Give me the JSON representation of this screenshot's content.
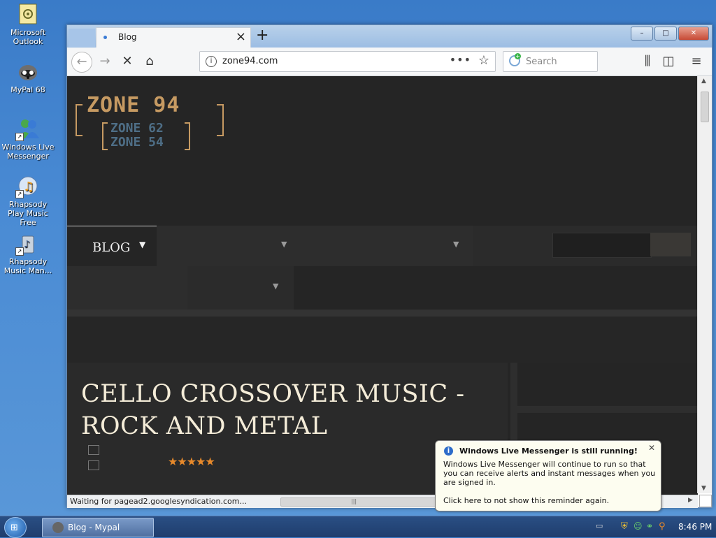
{
  "desktop_icons": [
    {
      "label": "Microsoft Outlook",
      "icon": "outlook-icon"
    },
    {
      "label": "MyPal 68",
      "icon": "raccoon-icon"
    },
    {
      "label": "Windows Live Messenger",
      "icon": "messenger-icon"
    },
    {
      "label": "Rhapsody Play Music Free",
      "icon": "rhapsody-icon"
    },
    {
      "label": "Rhapsody Music Man...",
      "icon": "rhapsody-icon"
    }
  ],
  "browser": {
    "tab_title": "Blog",
    "url": "zone94.com",
    "search_placeholder": "Search",
    "page_actions": "•••"
  },
  "site": {
    "logo_main": "ZONE 94",
    "logo_sub1": "ZONE 62",
    "logo_sub2": "ZONE 54",
    "nav_blog": "BLOG",
    "article_title": "CELLO CROSSOVER MUSIC - ROCK AND METAL",
    "rating_stars": "★★★★★",
    "rating": 5
  },
  "status": {
    "text": "Waiting for pagead2.googlesyndication.com..."
  },
  "balloon": {
    "title": "Windows Live Messenger is still running!",
    "body": "Windows Live Messenger will continue to run so that you can receive alerts and instant messages when you are signed in.",
    "link": "Click here to not show this reminder again."
  },
  "taskbar": {
    "task_label": "Blog - Mypal",
    "clock": "8:46 PM"
  },
  "colors": {
    "page_bg": "#252525",
    "logo_gold": "#c69a62",
    "logo_blue": "#4e6e86",
    "title_cream": "#f4ecd8",
    "star_orange": "#e6892b"
  }
}
